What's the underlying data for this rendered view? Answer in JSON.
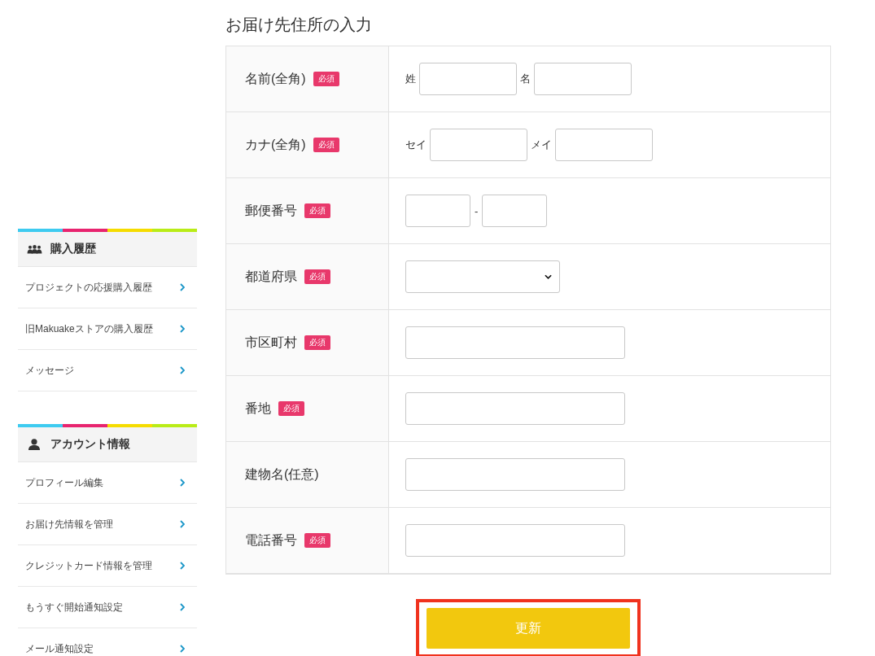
{
  "sidebar": {
    "sections": [
      {
        "title": "購入履歴",
        "items": [
          {
            "label": "プロジェクトの応援購入履歴"
          },
          {
            "label": "旧Makuakeストアの購入履歴"
          },
          {
            "label": "メッセージ"
          }
        ]
      },
      {
        "title": "アカウント情報",
        "items": [
          {
            "label": "プロフィール編集"
          },
          {
            "label": "お届け先情報を管理"
          },
          {
            "label": "クレジットカード情報を管理"
          },
          {
            "label": "もうすぐ開始通知設定"
          },
          {
            "label": "メール通知設定"
          }
        ]
      }
    ]
  },
  "form": {
    "title": "お届け先住所の入力",
    "rows": [
      {
        "label": "名前(全角)",
        "badge": "必須",
        "kind": "pair",
        "fields": [
          {
            "label": "姓"
          },
          {
            "label": "名"
          }
        ]
      },
      {
        "label": "カナ(全角)",
        "badge": "必須",
        "kind": "pair",
        "fields": [
          {
            "label": "セイ"
          },
          {
            "label": "メイ"
          }
        ]
      },
      {
        "label": "郵便番号",
        "badge": "必須",
        "kind": "postal",
        "separator": "-"
      },
      {
        "label": "都道府県",
        "badge": "必須",
        "kind": "select"
      },
      {
        "label": "市区町村",
        "badge": "必須",
        "kind": "text"
      },
      {
        "label": "番地",
        "badge": "必須",
        "kind": "text"
      },
      {
        "label": "建物名(任意)",
        "kind": "text"
      },
      {
        "label": "電話番号",
        "badge": "必須",
        "kind": "text"
      }
    ]
  },
  "submit": {
    "label": "更新",
    "highlighted": true
  }
}
